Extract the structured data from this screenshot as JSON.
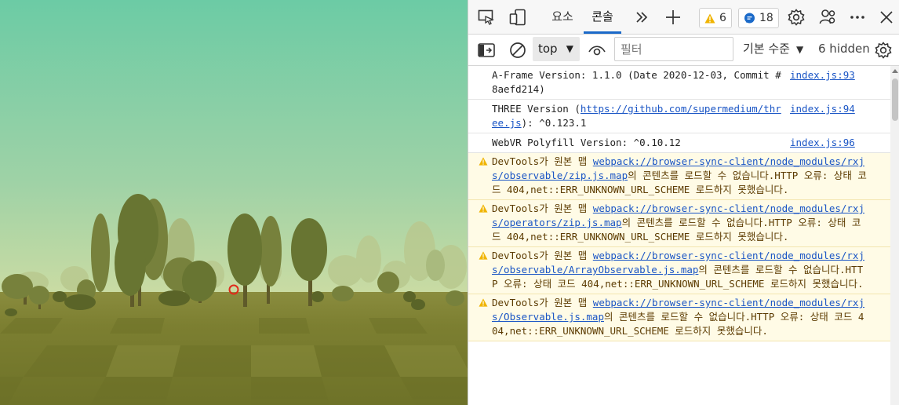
{
  "tabs": {
    "elements": "요소",
    "console": "콘솔"
  },
  "badges": {
    "warnings": "6",
    "messages": "18"
  },
  "toolbar": {
    "context": "top",
    "filter_placeholder": "필터",
    "levels": "기본 수준",
    "hidden": "6 hidden"
  },
  "messages": [
    {
      "level": "log",
      "text": "A-Frame Version: 1.1.0 (Date 2020-12-03, Commit #8aefd214)",
      "source": "index.js:93"
    },
    {
      "level": "log",
      "prefix": "THREE Version (",
      "link": "https://github.com/supermedium/three.js",
      "suffix": "): ^0.123.1",
      "source": "index.js:94"
    },
    {
      "level": "log",
      "text": "WebVR Polyfill Version: ^0.10.12",
      "source": "index.js:96"
    },
    {
      "level": "warn",
      "prefix": "DevTools가 원본 맵 ",
      "link": "webpack://browser-sync-client/node_modules/rxjs/observable/zip.js.map",
      "suffix": "의 콘텐츠를 로드할 수 없습니다.HTTP 오류: 상태 코드 404,net::ERR_UNKNOWN_URL_SCHEME 로드하지 못했습니다."
    },
    {
      "level": "warn",
      "prefix": "DevTools가 원본 맵 ",
      "link": "webpack://browser-sync-client/node_modules/rxjs/operators/zip.js.map",
      "suffix": "의 콘텐츠를 로드할 수 없습니다.HTTP 오류: 상태 코드 404,net::ERR_UNKNOWN_URL_SCHEME 로드하지 못했습니다."
    },
    {
      "level": "warn",
      "prefix": "DevTools가 원본 맵 ",
      "link": "webpack://browser-sync-client/node_modules/rxjs/observable/ArrayObservable.js.map",
      "suffix": "의 콘텐츠를 로드할 수 없습니다.HTTP 오류: 상태 코드 404,net::ERR_UNKNOWN_URL_SCHEME 로드하지 못했습니다."
    },
    {
      "level": "warn",
      "prefix": "DevTools가 원본 맵 ",
      "link": "webpack://browser-sync-client/node_modules/rxjs/Observable.js.map",
      "suffix": "의 콘텐츠를 로드할 수 없습니다.HTTP 오류: 상태 코드 404,net::ERR_UNKNOWN_URL_SCHEME 로드하지 못했습니다."
    }
  ],
  "colors": {
    "sky_top": "#6fcca4",
    "sky_horizon": "#c6d9a2",
    "ground": "#76792c",
    "tree_dark": "#5a6428",
    "tree_light": "#8e9446",
    "cursor": "#e02a1a",
    "accent_tab": "#1b6ac9",
    "warning_bg": "#fffbe6",
    "warning_icon": "#f0b400",
    "info_badge": "#1b6ac9",
    "link": "#1a55c5"
  },
  "icons": [
    "inspect-icon",
    "device-emulation-icon",
    "more-tabs-icon",
    "add-tab-icon",
    "warning-icon",
    "message-icon",
    "settings-icon",
    "customize-icon",
    "more-options-icon",
    "close-icon",
    "sidebar-toggle-icon",
    "clear-console-icon",
    "eye-icon",
    "console-settings-icon"
  ]
}
